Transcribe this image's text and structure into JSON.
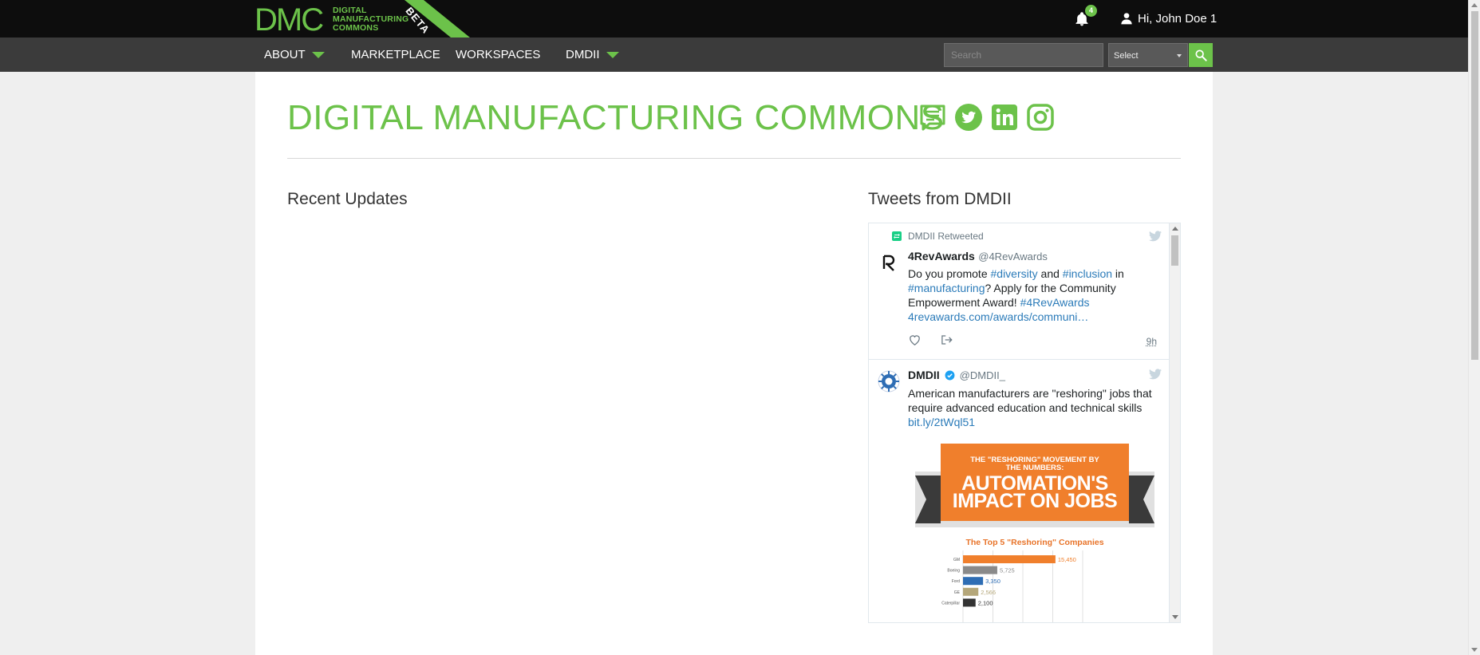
{
  "header": {
    "logo_text": "DMC",
    "logo_sub": [
      "DIGITAL",
      "MANUFACTURING",
      "COMMONS"
    ],
    "beta_label": "BETA",
    "notification_count": "4",
    "user_greeting": "Hi, John Doe 1"
  },
  "nav": {
    "items": [
      {
        "label": "ABOUT",
        "has_dropdown": true
      },
      {
        "label": "MARKETPLACE",
        "has_dropdown": false
      },
      {
        "label": "WORKSPACES",
        "has_dropdown": false
      },
      {
        "label": "DMDII",
        "has_dropdown": true
      }
    ],
    "search_placeholder": "Search",
    "select_value": "Select"
  },
  "main": {
    "title": "DIGITAL MANUFACTURING COMMONS",
    "social_icons": [
      "chat-icon",
      "twitter-icon",
      "linkedin-icon",
      "instagram-icon"
    ],
    "recent_updates_heading": "Recent Updates",
    "tweets_heading": "Tweets from DMDII"
  },
  "tweets": [
    {
      "retweet_label": "DMDII Retweeted",
      "name": "4RevAwards",
      "handle": "@4RevAwards",
      "text_parts": [
        {
          "t": "Do you promote ",
          "link": false
        },
        {
          "t": "#diversity",
          "link": true
        },
        {
          "t": " and ",
          "link": false
        },
        {
          "t": "#inclusion",
          "link": true
        },
        {
          "t": " in ",
          "link": false
        },
        {
          "t": "#manufacturing",
          "link": true
        },
        {
          "t": "? Apply for the Community Empowerment Award! ",
          "link": false
        },
        {
          "t": "#4RevAwards",
          "link": true
        },
        {
          "t": " ",
          "link": false
        },
        {
          "t": "4revawards.com/awards/communi…",
          "link": true
        }
      ],
      "time": "9h"
    },
    {
      "name": "DMDII",
      "handle": "@DMDII_",
      "verified": true,
      "text": "American manufacturers are \"reshoring\" jobs that require advanced education and technical skills",
      "link": "bit.ly/2tWql51",
      "image": {
        "banner_top": "THE \"RESHORING\" MOVEMENT BY THE NUMBERS:",
        "banner_main_1": "AUTOMATION'S",
        "banner_main_2": "IMPACT ON JOBS",
        "chart_title": "The Top 5 \"Reshoring\" Companies"
      }
    }
  ],
  "chart_data": {
    "type": "bar",
    "title": "The Top 5 \"Reshoring\" Companies",
    "categories": [
      "GM",
      "Boeing",
      "Ford",
      "GE",
      "Caterpillar"
    ],
    "values": [
      15450,
      5725,
      3350,
      2566,
      2100
    ],
    "value_labels": [
      "15,450",
      "5,725",
      "3,350",
      "2,566",
      "2,100"
    ],
    "colors": [
      "#f07f2c",
      "#8a8a8a",
      "#2e6db4",
      "#b5a77a",
      "#333333"
    ],
    "xlim": [
      0,
      20000
    ]
  },
  "colors": {
    "accent": "#6cc24a",
    "topbar": "#0d0d0d",
    "navbar": "#3b3b3b",
    "link": "#2b7bb9"
  }
}
